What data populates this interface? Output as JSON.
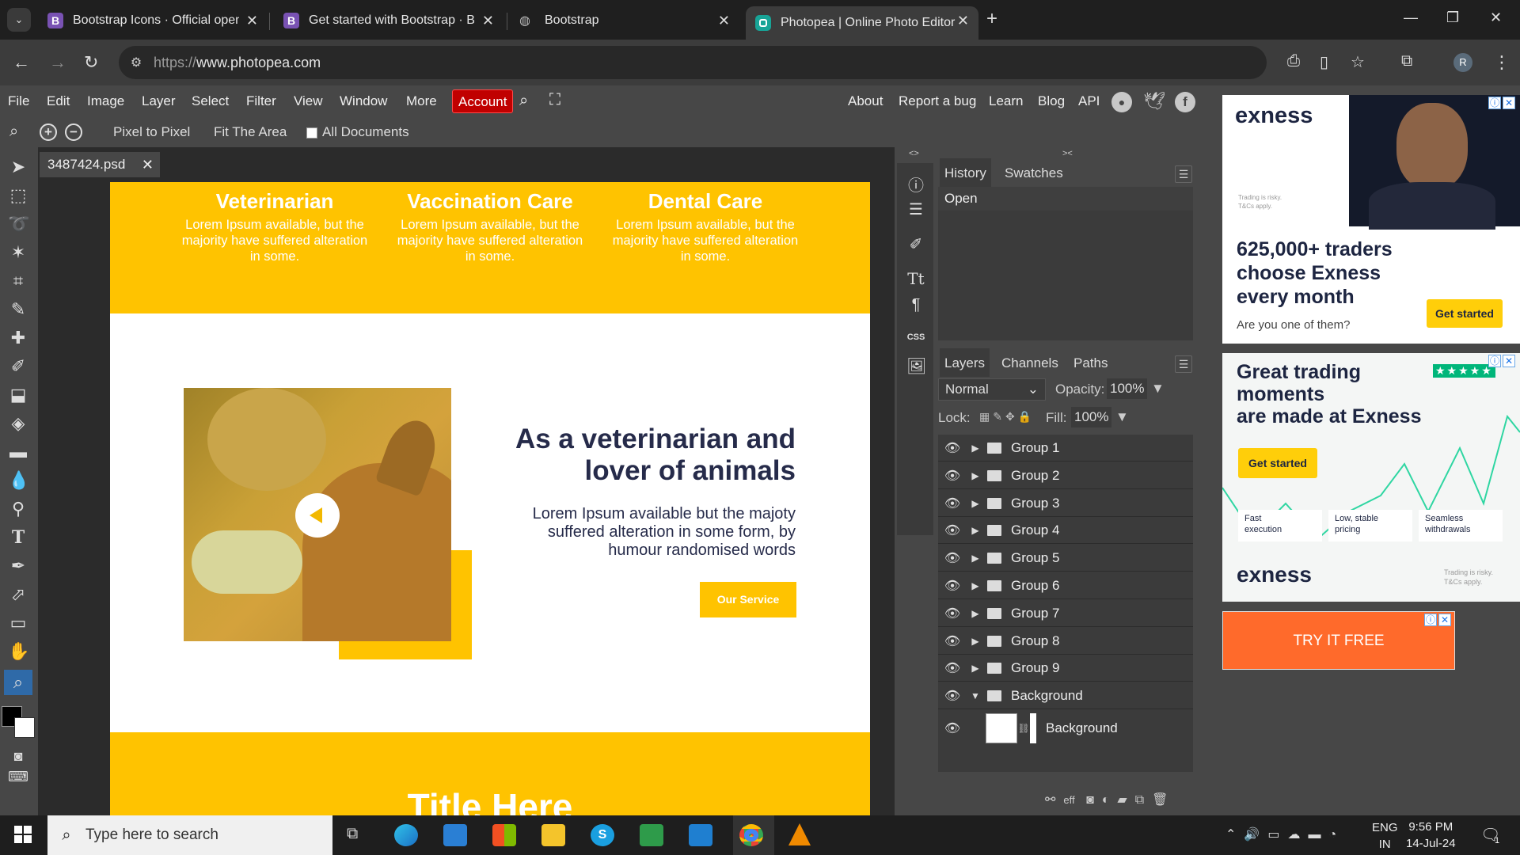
{
  "browser": {
    "tabs": [
      {
        "title": "Bootstrap Icons · Official open s",
        "favicon": "B",
        "favicon_color": "#7952b3"
      },
      {
        "title": "Get started with Bootstrap · Boo",
        "favicon": "B",
        "favicon_color": "#7952b3"
      },
      {
        "title": "Bootstrap",
        "favicon": "globe-icon"
      },
      {
        "title": "Photopea | Online Photo Editor",
        "favicon": "photopea-icon",
        "favicon_color": "#18a497"
      }
    ],
    "url_protocol": "https://",
    "url_host": "www.photopea.com",
    "profile_initial": "R"
  },
  "photopea": {
    "menu": [
      "File",
      "Edit",
      "Image",
      "Layer",
      "Select",
      "Filter",
      "View",
      "Window",
      "More"
    ],
    "account_label": "Account",
    "right_links": [
      "About",
      "Report a bug",
      "Learn",
      "Blog",
      "API"
    ],
    "options": {
      "pixel_to_pixel": "Pixel to Pixel",
      "fit_area": "Fit The Area",
      "all_documents": "All Documents"
    },
    "document_tab": "3487424.psd",
    "canvas": {
      "services": [
        {
          "title": "Veterinarian",
          "text": "Lorem Ipsum available, but the majority have suffered alteration in some."
        },
        {
          "title": "Vaccination Care",
          "text": "Lorem Ipsum available, but the majority have suffered alteration in some."
        },
        {
          "title": "Dental Care",
          "text": "Lorem Ipsum available, but the majority have suffered alteration in some."
        }
      ],
      "headline_line1": "As a veterinarian and",
      "headline_line2": "lover of animals",
      "body_line1": "Lorem Ipsum available but the majoty",
      "body_line2": "suffered alteration in some form, by",
      "body_line3": "humour randomised words",
      "cta": "Our Service",
      "section_title": "Title Here",
      "accent": "#ffc300",
      "text_color": "#262b4a"
    },
    "history": {
      "tabs": [
        "History",
        "Swatches"
      ],
      "entries": [
        "Open"
      ]
    },
    "layers": {
      "tabs": [
        "Layers",
        "Channels",
        "Paths"
      ],
      "blend_mode": "Normal",
      "opacity_label": "Opacity:",
      "opacity": "100%",
      "lock_label": "Lock:",
      "fill_label": "Fill:",
      "fill": "100%",
      "groups": [
        "Group 1",
        "Group 2",
        "Group 3",
        "Group 4",
        "Group 5",
        "Group 6",
        "Group 7",
        "Group 8",
        "Group 9"
      ],
      "background_group": "Background",
      "background_layer": "Background"
    }
  },
  "ads": {
    "ad1": {
      "brand": "exness",
      "headline1": "625,000+ traders",
      "headline2": "choose Exness",
      "headline3": "every month",
      "sub": "Are you one of them?",
      "button": "Get started",
      "risk1": "Trading is risky.",
      "risk2": "T&Cs apply."
    },
    "ad2": {
      "headline1": "Great trading",
      "headline2": "moments",
      "headline3": "are made at Exness",
      "button": "Get started",
      "features": [
        [
          "Fast",
          "execution"
        ],
        [
          "Low, stable",
          "pricing"
        ],
        [
          "Seamless",
          "withdrawals"
        ]
      ],
      "brand": "exness",
      "risk1": "Trading is risky.",
      "risk2": "T&Cs apply."
    },
    "ad3": {
      "label": "TRY IT FREE"
    }
  },
  "taskbar": {
    "search_placeholder": "Type here to search",
    "lang1": "ENG",
    "lang2": "IN",
    "time": "9:56 PM",
    "date": "14-Jul-24",
    "notif_count": "1"
  }
}
